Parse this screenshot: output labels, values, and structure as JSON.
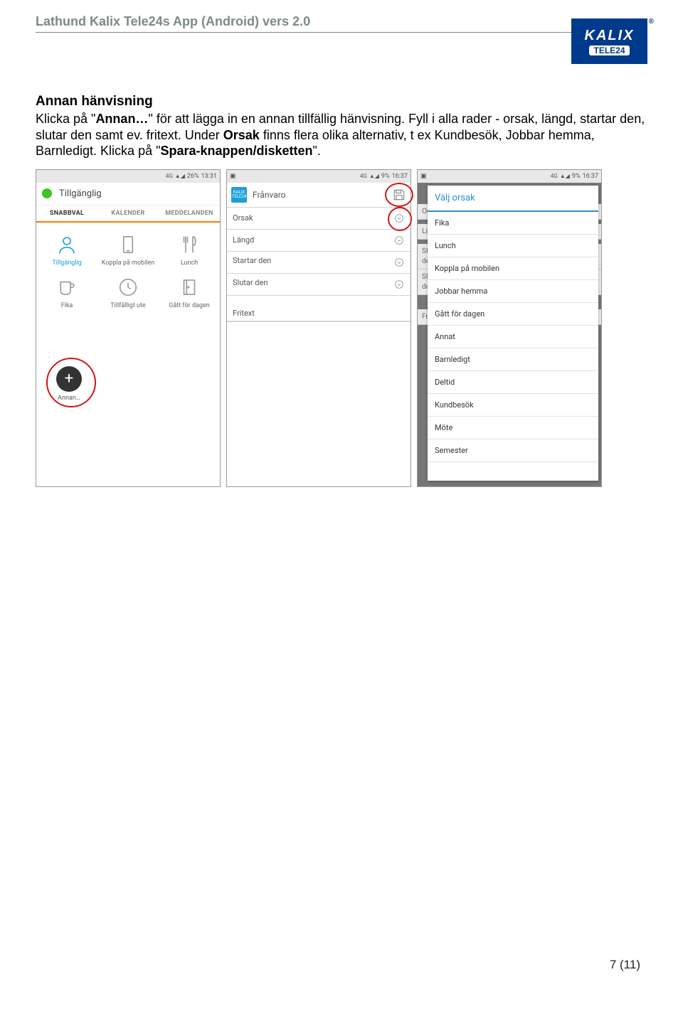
{
  "header": {
    "title": "Lathund Kalix Tele24s App (Android) vers 2.0"
  },
  "logo": {
    "line1": "KALIX",
    "line2": "TELE24",
    "reg": "®"
  },
  "section": {
    "heading": "Annan hänvisning",
    "p1a": "Klicka på \"",
    "p1b": "Annan…",
    "p1c": "\" för att lägga in en annan tillfällig hänvisning. Fyll i alla rader - orsak, längd, startar den, slutar den samt ev. fritext.  Under ",
    "p1d": "Orsak",
    "p1e": " finns flera olika alternativ, t ex Kundbesök, Jobbar hemma, Barnledigt. Klicka på \"",
    "p1f": "Spara-knappen/disketten",
    "p1g": "\"."
  },
  "shot1": {
    "sbar": {
      "left": "",
      "net": "4G",
      "sig": "▲◢",
      "batt": "26%",
      "time": "13:31"
    },
    "status": "Tillgänglig",
    "tabs": [
      "SNABBVAL",
      "KALENDER",
      "MEDDELANDEN"
    ],
    "grid": [
      {
        "label": "Tillgänglig"
      },
      {
        "label": "Koppla på mobilen"
      },
      {
        "label": "Lunch"
      },
      {
        "label": "Fika"
      },
      {
        "label": "Tillfälligt ute"
      },
      {
        "label": "Gått för dagen"
      }
    ],
    "annan": "Annan…"
  },
  "shot2": {
    "sbar": {
      "left": "▣",
      "net": "4G",
      "sig": "▲◢",
      "batt": "9%",
      "time": "16:37"
    },
    "title": "Frånvaro",
    "rows": {
      "orsak": "Orsak",
      "langd": "Längd",
      "startar": "Startar den",
      "slutar": "Slutar den"
    },
    "fritext": "Fritext"
  },
  "shot3": {
    "sbar": {
      "left": "▣",
      "net": "4G",
      "sig": "▲◢",
      "batt": "9%",
      "time": "16:37"
    },
    "bgrows": {
      "or": "Or",
      "la": "Lä",
      "st1": "St",
      "de1": "de",
      "sl": "Sl",
      "de2": "de",
      "fr": "Fr"
    },
    "dialog": {
      "title": "Välj orsak",
      "items": [
        "Fika",
        "Lunch",
        "Koppla på mobilen",
        "Jobbar hemma",
        "Gått för dagen",
        "Annat",
        "Barnledigt",
        "Deltid",
        "Kundbesök",
        "Möte",
        "Semester"
      ]
    }
  },
  "footer": {
    "page": "7 (11)"
  }
}
